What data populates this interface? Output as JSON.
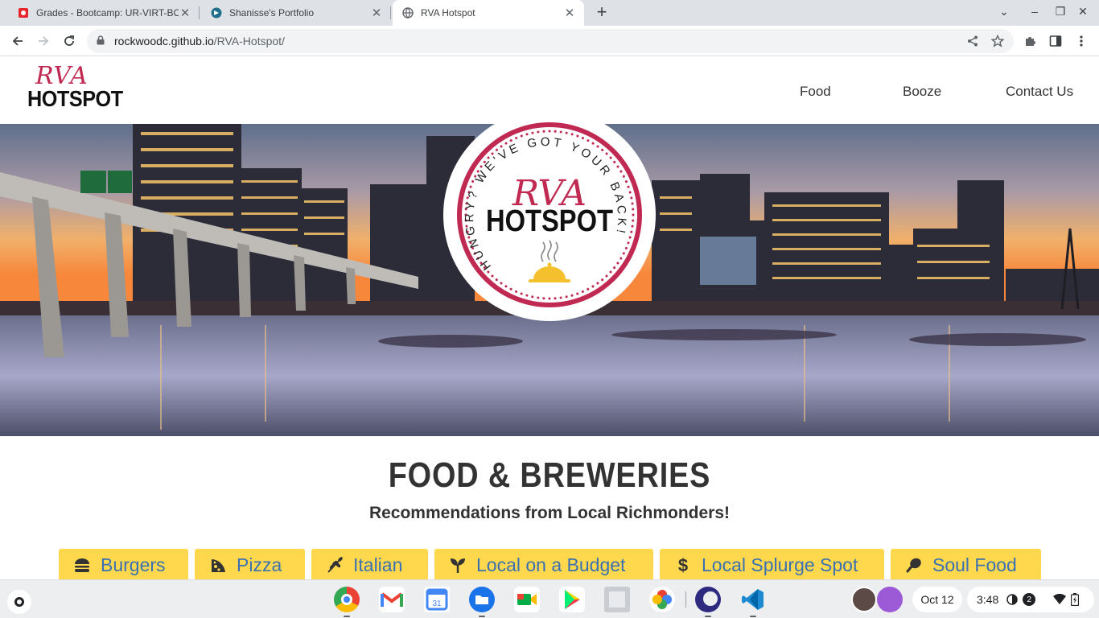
{
  "browser": {
    "tabs": [
      {
        "title": "Grades - Bootcamp: UR-VIRT-BO-"
      },
      {
        "title": "Shanisse's Portfolio"
      },
      {
        "title": "RVA Hotspot"
      }
    ],
    "url_host": "rockwoodc.github.io",
    "url_path": "/RVA-Hotspot/"
  },
  "site": {
    "logo": {
      "script": "RVA",
      "bold": "HOTSPOT"
    },
    "nav": [
      {
        "label": "Food"
      },
      {
        "label": "Booze"
      },
      {
        "label": "Contact Us"
      }
    ],
    "badge": {
      "ring_text": "HUNGRY? WE'VE GOT YOUR BACK!",
      "script": "RVA",
      "bold": "HOTSPOT"
    },
    "section_title": "FOOD & BREWERIES",
    "section_subtitle": "Recommendations from Local Richmonders!",
    "categories": [
      {
        "label": "Burgers",
        "icon": "burger-icon"
      },
      {
        "label": "Pizza",
        "icon": "pizza-icon"
      },
      {
        "label": "Italian",
        "icon": "wheat-icon"
      },
      {
        "label": "Local on a Budget",
        "icon": "seedling-icon"
      },
      {
        "label": "Local Splurge Spot",
        "icon": "dollar-icon"
      },
      {
        "label": "Soul Food",
        "icon": "drumstick-icon"
      }
    ]
  },
  "shelf": {
    "date": "Oct 12",
    "time": "3:48",
    "notification_count": "2"
  },
  "colors": {
    "accent_pink": "#c02a52",
    "button_yellow": "#ffd84d",
    "button_text_blue": "#3b71b0"
  }
}
